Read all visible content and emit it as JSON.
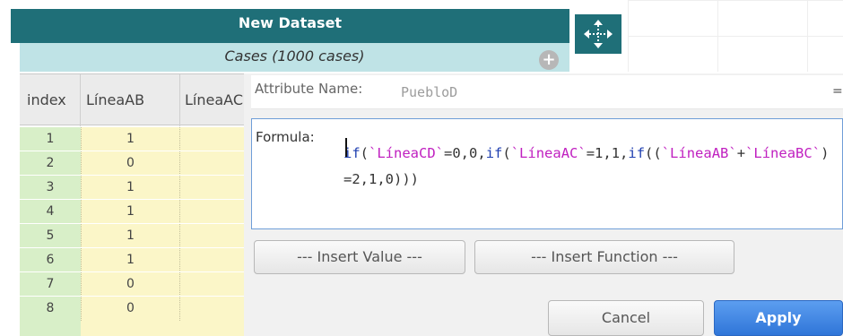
{
  "window": {
    "title": "New Dataset"
  },
  "table": {
    "cases_label": "Cases (1000 cases)",
    "add_icon": "+",
    "columns": [
      "index",
      "LíneaAB",
      "LíneaAC"
    ],
    "rows": [
      {
        "index": "1",
        "LineaAB": "1"
      },
      {
        "index": "2",
        "LineaAB": "0"
      },
      {
        "index": "3",
        "LineaAB": "1"
      },
      {
        "index": "4",
        "LineaAB": "1"
      },
      {
        "index": "5",
        "LineaAB": "1"
      },
      {
        "index": "6",
        "LineaAB": "1"
      },
      {
        "index": "7",
        "LineaAB": "0"
      },
      {
        "index": "8",
        "LineaAB": "0"
      }
    ]
  },
  "dialog": {
    "attribute_label": "Attribute Name:",
    "attribute_value": "PuebloD",
    "eq_mark": "=",
    "formula_label": "Formula:",
    "formula_tokens": [
      {
        "t": "if",
        "c": "kw"
      },
      {
        "t": "(",
        "c": "num"
      },
      {
        "t": "`LíneaCD`",
        "c": "str"
      },
      {
        "t": "=0,0,",
        "c": "num"
      },
      {
        "t": "if",
        "c": "kw"
      },
      {
        "t": "(",
        "c": "num"
      },
      {
        "t": "`LíneaAC`",
        "c": "str"
      },
      {
        "t": "=1,1,",
        "c": "num"
      },
      {
        "t": "if",
        "c": "kw"
      },
      {
        "t": "((",
        "c": "num"
      },
      {
        "t": "`LíneaAB`",
        "c": "str"
      },
      {
        "t": "+",
        "c": "num"
      },
      {
        "t": "`LíneaBC`",
        "c": "str"
      },
      {
        "t": ")=2,1,0)))",
        "c": "num"
      }
    ],
    "insert_value_label": "--- Insert Value ---",
    "insert_function_label": "--- Insert Function ---",
    "cancel_label": "Cancel",
    "apply_label": "Apply"
  },
  "icons": {
    "move": "move-arrows-icon",
    "add": "plus-circle-icon"
  },
  "colors": {
    "title_bg": "#1f6f78",
    "cases_bg": "#bfe3e6",
    "index_bg": "#d8efc8",
    "cell_bg": "#fbf6c8",
    "apply_bg": "#2f75d8"
  }
}
